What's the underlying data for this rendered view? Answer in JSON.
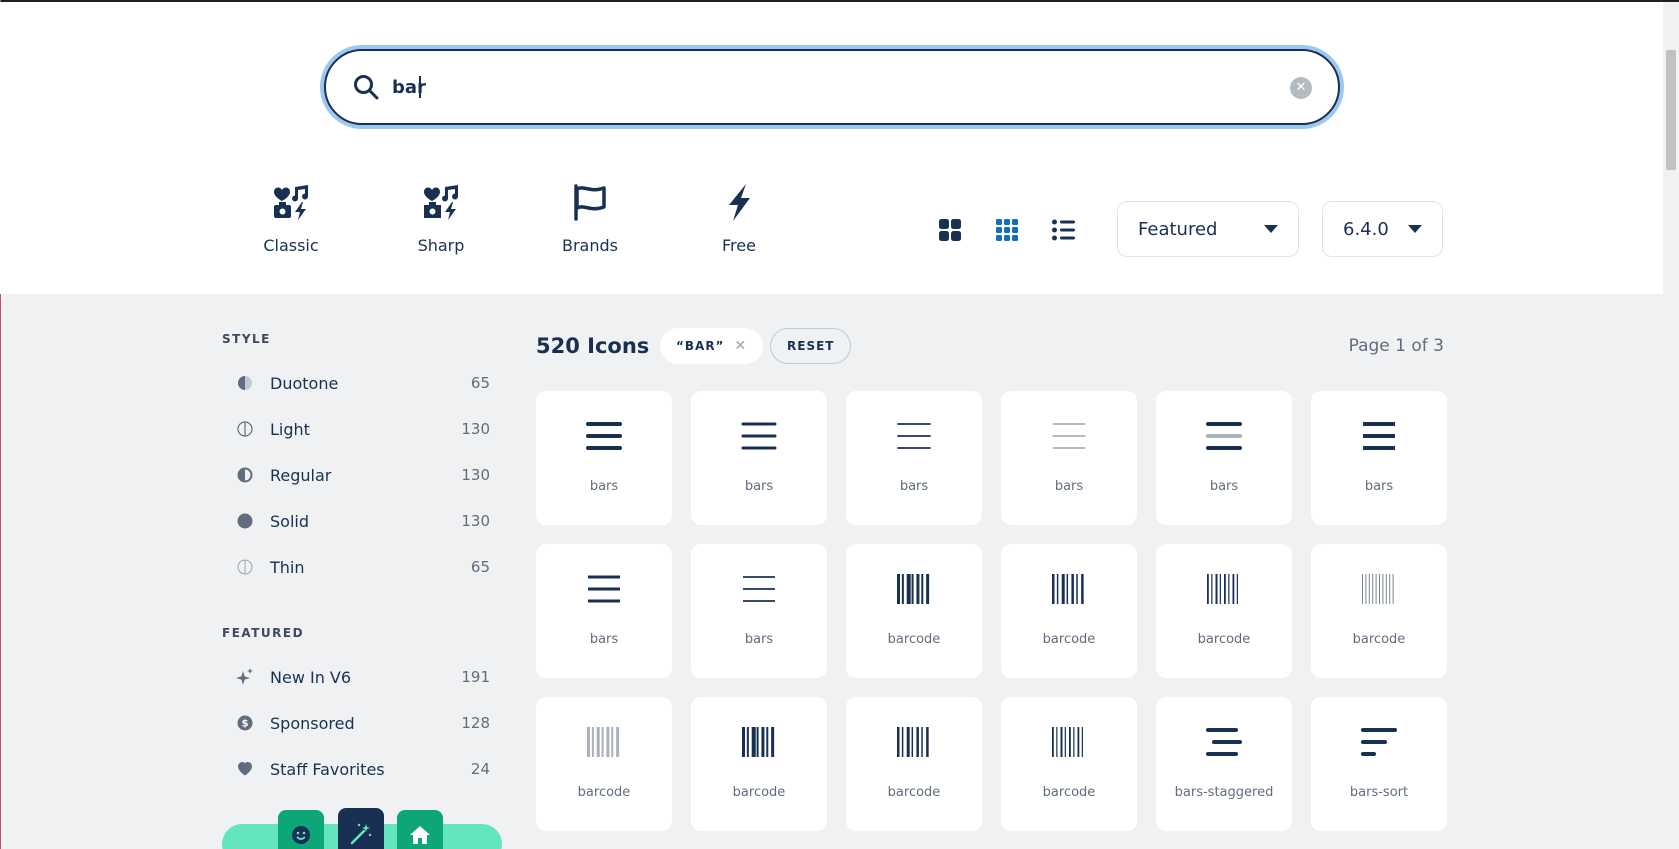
{
  "search": {
    "value": "bar",
    "placeholder": ""
  },
  "families": [
    {
      "label": "Classic",
      "icon": "classic-icon"
    },
    {
      "label": "Sharp",
      "icon": "sharp-icon"
    },
    {
      "label": "Brands",
      "icon": "flag-icon"
    },
    {
      "label": "Free",
      "icon": "bolt-icon"
    }
  ],
  "view_modes": [
    "grid-large-icon",
    "grid-small-icon",
    "list-icon"
  ],
  "sort_select": {
    "value": "Featured"
  },
  "version_select": {
    "value": "6.4.0"
  },
  "sidebar": {
    "style_title": "STYLE",
    "styles": [
      {
        "label": "Duotone",
        "count": "65",
        "icon": "duotone-icon"
      },
      {
        "label": "Light",
        "count": "130",
        "icon": "light-icon"
      },
      {
        "label": "Regular",
        "count": "130",
        "icon": "regular-icon"
      },
      {
        "label": "Solid",
        "count": "130",
        "icon": "solid-icon"
      },
      {
        "label": "Thin",
        "count": "65",
        "icon": "thin-icon"
      }
    ],
    "featured_title": "FEATURED",
    "featured": [
      {
        "label": "New In V6",
        "count": "191",
        "icon": "sparkles-icon"
      },
      {
        "label": "Sponsored",
        "count": "128",
        "icon": "dollar-icon"
      },
      {
        "label": "Staff Favorites",
        "count": "24",
        "icon": "heart-icon"
      }
    ]
  },
  "results": {
    "count_label": "520 Icons",
    "query_chip": "“BAR”",
    "reset_label": "RESET",
    "page_info": "Page 1 of 3",
    "icons": [
      {
        "label": "bars",
        "kind": "bars-bold"
      },
      {
        "label": "bars",
        "kind": "bars-regular"
      },
      {
        "label": "bars",
        "kind": "bars-light"
      },
      {
        "label": "bars",
        "kind": "bars-thin"
      },
      {
        "label": "bars",
        "kind": "bars-duotone"
      },
      {
        "label": "bars",
        "kind": "bars-sharp"
      },
      {
        "label": "bars",
        "kind": "bars-sharp-regular"
      },
      {
        "label": "bars",
        "kind": "bars-sharp-light"
      },
      {
        "label": "barcode",
        "kind": "barcode-solid"
      },
      {
        "label": "barcode",
        "kind": "barcode-regular"
      },
      {
        "label": "barcode",
        "kind": "barcode-light"
      },
      {
        "label": "barcode",
        "kind": "barcode-thin"
      },
      {
        "label": "barcode",
        "kind": "barcode-duotone"
      },
      {
        "label": "barcode",
        "kind": "barcode-sharp"
      },
      {
        "label": "barcode",
        "kind": "barcode-sharp-regular"
      },
      {
        "label": "barcode",
        "kind": "barcode-sharp-light"
      },
      {
        "label": "bars-staggered",
        "kind": "bars-staggered"
      },
      {
        "label": "bars-sort",
        "kind": "bars-sort"
      }
    ]
  },
  "colors": {
    "navy": "#183153",
    "accent_blue": "#146ebe",
    "mint": "#63e6be",
    "focus_ring": "#9cc8ef"
  }
}
